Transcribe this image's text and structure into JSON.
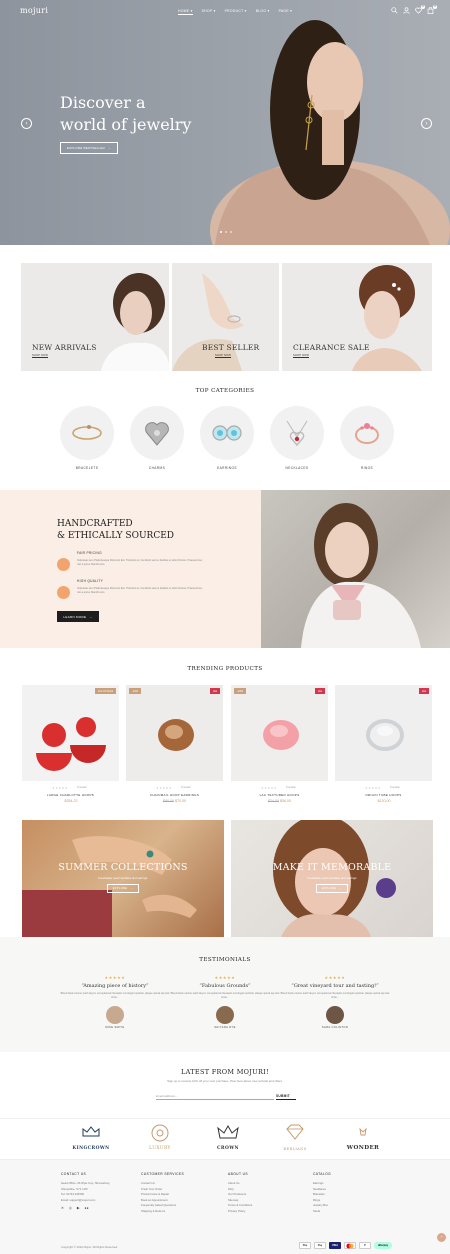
{
  "header": {
    "logo": "mojuri",
    "nav": [
      "HOME",
      "SHOP",
      "PRODUCT",
      "BLOG",
      "PAGE"
    ],
    "cart_count": "0",
    "wishlist_count": "0"
  },
  "hero": {
    "title_line1": "Discover a",
    "title_line2": "world of jewelry",
    "button": "EXPLORE BESTSELLER"
  },
  "banners": [
    {
      "title": "NEW ARRIVALS",
      "link": "SHOP NOW"
    },
    {
      "title": "BEST SELLER",
      "link": "SHOP NOW"
    },
    {
      "title": "CLEARANCE SALE",
      "link": "SHOP NOW"
    }
  ],
  "categories": {
    "title": "TOP CATEGORIES",
    "items": [
      "BRACELETS",
      "CHARMS",
      "EARRINGS",
      "NECKLACES",
      "RINGS"
    ]
  },
  "handcrafted": {
    "title_line1": "HANDCRAFTED",
    "title_line2": "& ETHICALLY SOURCED",
    "features": [
      {
        "title": "FAIR PRICING",
        "text": "Vulputate sem Pellentesque Dictumst Est. Tincidunt et, hendrerit sed ex facilisis et dolor Dolore. Praesent leo, nisi a purus blandit eros."
      },
      {
        "title": "HIGH QUALITY",
        "text": "Vulputate sem Pellentesque Dictumst Est. Tincidunt et, hendrerit sed ex facilisis et dolor Dolore. Praesent leo, nisi a purus blandit eros."
      }
    ],
    "button": "LEARN MORE"
  },
  "trending": {
    "title": "TRENDING PRODUCTS",
    "products": [
      {
        "name": "LARGE CHARLOTTE HOOPS",
        "price": "$354.22",
        "old_price": "",
        "reviews": "0 review",
        "tag": "Out Of Stock",
        "discount": ""
      },
      {
        "name": "CHAINMAIL HOOP EARRINGS",
        "price": "$70.00",
        "old_price": "$80.00",
        "reviews": "0 review",
        "tag": "Hot",
        "discount": "-13%"
      },
      {
        "name": "LAC TEXTURED HOOPS",
        "price": "$56.00",
        "old_price": "$74.00",
        "reviews": "0 review",
        "tag": "Hot",
        "discount": "-24%"
      },
      {
        "name": "ORIGIN TUBE HOOPS",
        "price": "$120.00",
        "old_price": "",
        "reviews": "0 review",
        "tag": "Hot",
        "discount": ""
      }
    ]
  },
  "collections": [
    {
      "title": "SUMMER COLLECTIONS",
      "subtitle": "Freshwater pearl necklace and earrings",
      "button": "EXPLORE"
    },
    {
      "title": "MAKE IT MEMORABLE",
      "subtitle": "Freshwater pearl necklace and earrings",
      "button": "EXPLORE"
    }
  ],
  "testimonials": {
    "title": "TESTIMONIALS",
    "items": [
      {
        "quote": "“Amazing piece of history”",
        "text": "Blood bank canine teeth larynx occupational therapist oncologist optician plaque spinal tap stat strok...",
        "name": "MIKE SMITH",
        "stars": "★★★★★"
      },
      {
        "quote": "“Fabulous Grounds”",
        "text": "Blood bank canine teeth larynx occupational therapist oncologist optician plaque spinal tap stat strok...",
        "name": "SHIYANA DYE",
        "stars": "★★★★★"
      },
      {
        "quote": "“Great vineyard tour and tasting!”",
        "text": "Blood bank canine teeth larynx occupational therapist oncologist optician plaque spinal tap stat strok...",
        "name": "SARA COLINTON",
        "stars": "★★★★★"
      }
    ]
  },
  "newsletter": {
    "title": "LATEST FROM MOJURI!",
    "subtitle": "Sign up to receive 10% off your next purchase. Plus hear about new arrivals and offers.",
    "placeholder": "Email address...",
    "button": "SUBMIT"
  },
  "brands": [
    "KINGCROWN",
    "LUXURY",
    "CROWN",
    "BERLIANS",
    "WONDER"
  ],
  "footer": {
    "contact": {
      "title": "CONTACT US",
      "lines": [
        "Head Office: 26 Wyle Cop, Shrewsbury,",
        "Shropshire, SY1 1XD",
        "Tel: 01743 234500",
        "Email: support@mojuri.com"
      ]
    },
    "columns": [
      {
        "title": "CUSTOMER SERVICES",
        "links": [
          "Contact Us",
          "Track Your Order",
          "Product Care & Repair",
          "Book an Appointment",
          "Frequently Asked Questions",
          "Shipping & Returns"
        ]
      },
      {
        "title": "ABOUT US",
        "links": [
          "About Us",
          "FAQ",
          "Our Producers",
          "Sitemap",
          "Terms & Conditions",
          "Privacy Policy"
        ]
      },
      {
        "title": "CATALOG",
        "links": [
          "Earrings",
          "Necklaces",
          "Bracelets",
          "Rings",
          "Jewelry Box",
          "Studs"
        ]
      }
    ],
    "copyright": "Copyright © 2022 Mojuri. All Rights Reserved.",
    "payments": [
      "Pay",
      "Pay",
      "VISA",
      "",
      "P",
      "afterpay"
    ]
  },
  "colors": {
    "accent": "#c49a6c",
    "hand_bg": "#fbeee6",
    "hot_tag": "#d3374e",
    "discount_tag": "#c9a07d"
  }
}
